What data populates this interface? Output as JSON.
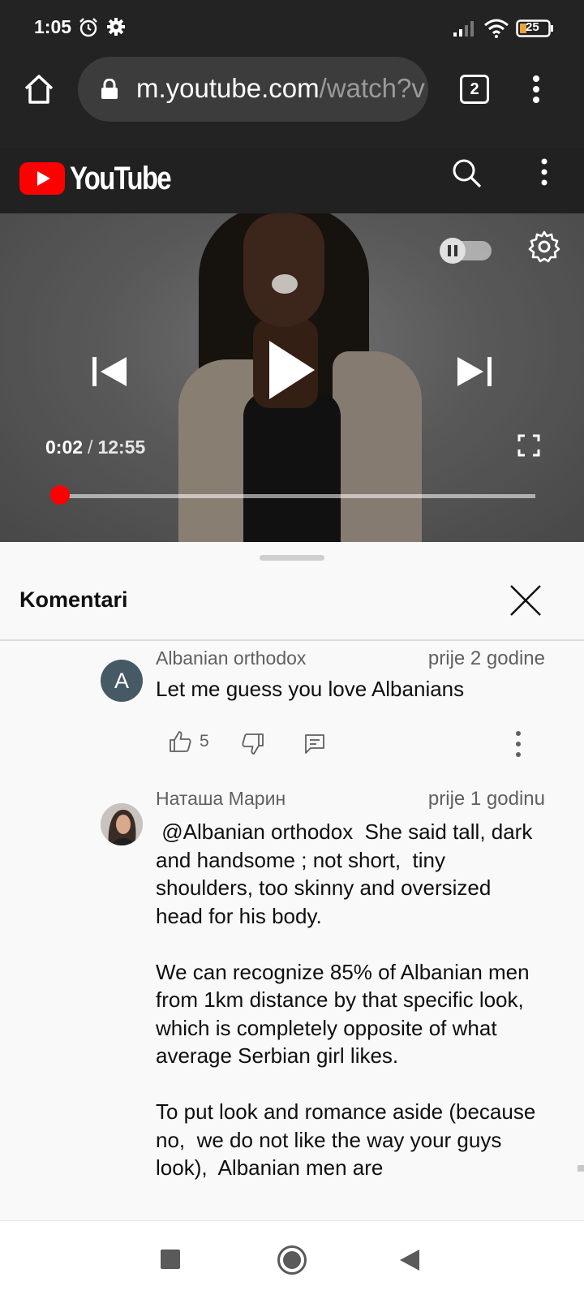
{
  "status_bar": {
    "time": "1:05",
    "battery_level": "25",
    "icons": [
      "alarm-icon",
      "settings-gear-icon",
      "signal-icon",
      "wifi-icon",
      "battery-icon"
    ]
  },
  "browser": {
    "url_domain": "m.youtube.com",
    "url_path": "/watch?v",
    "tab_count": "2",
    "icons": [
      "home-icon",
      "lock-icon",
      "tabs-icon",
      "menu-dots-icon"
    ]
  },
  "youtube": {
    "logo_text": "YouTube",
    "icons": [
      "search-icon",
      "more-vert-icon"
    ]
  },
  "player": {
    "current_time": "0:02",
    "separator": "/",
    "duration": "12:55",
    "progress_fraction": 0.0027,
    "autoplay": "paused",
    "icons": [
      "autoplay-toggle-icon",
      "settings-icon",
      "previous-icon",
      "play-icon",
      "next-icon",
      "fullscreen-icon"
    ]
  },
  "comments": {
    "title": "Komentari",
    "items": [
      {
        "author": "Albanian orthodox",
        "avatar_letter": "A",
        "date": "prije 2 godine",
        "text": "Let me guess you love Albanians",
        "likes": "5"
      },
      {
        "author": "Наташа Марин",
        "date": "prije 1 godinu",
        "paragraphs": [
          " @Albanian orthodox  She said tall, dark and handsome ; not short,  tiny shoulders, too skinny and oversized head for his body.",
          "We can recognize 85% of Albanian men from 1km distance by that specific look,  which is completely opposite of what average Serbian girl likes.",
          "To put look and romance aside (because no,  we do not like the way your guys look),  Albanian men are"
        ]
      }
    ]
  },
  "nav_bar": {
    "icons": [
      "recents-square-icon",
      "home-circle-icon",
      "back-triangle-icon"
    ]
  },
  "colors": {
    "dark_bar": "#232323",
    "youtube_red": "#ff0000",
    "sheet_bg": "#f9f9f9",
    "secondary_text": "#606060"
  }
}
